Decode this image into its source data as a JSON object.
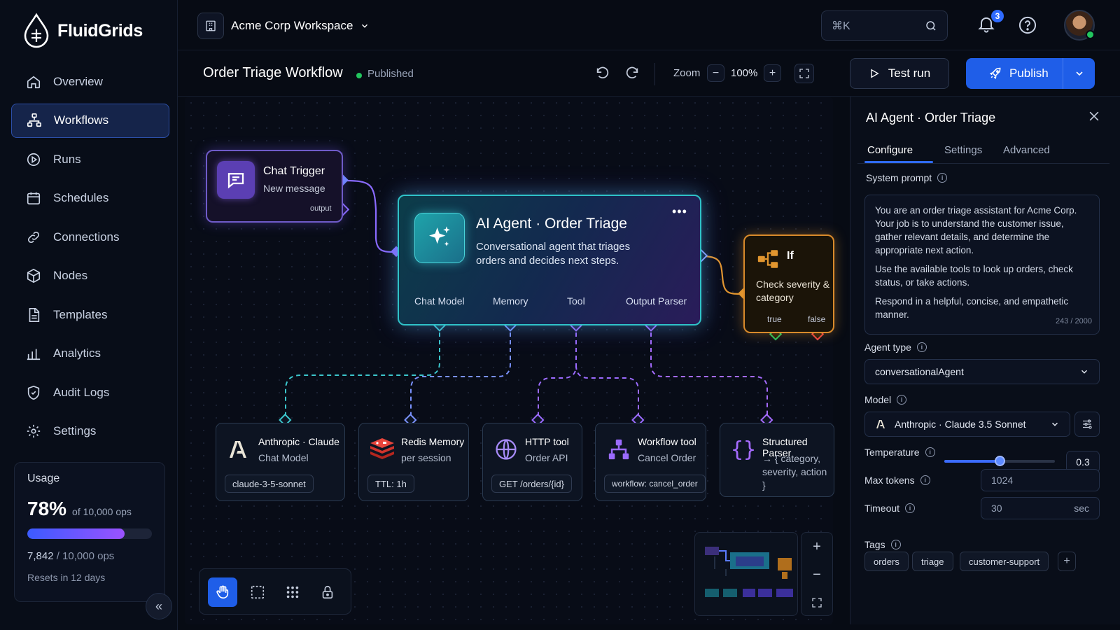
{
  "app": {
    "name": "FluidGrids"
  },
  "sidebar": {
    "items": [
      {
        "label": "Overview",
        "icon": "home-icon"
      },
      {
        "label": "Workflows",
        "icon": "workflow-icon",
        "active": true
      },
      {
        "label": "Runs",
        "icon": "play-circle-icon"
      },
      {
        "label": "Schedules",
        "icon": "calendar-icon"
      },
      {
        "label": "Connections",
        "icon": "link-icon"
      },
      {
        "label": "Nodes",
        "icon": "cube-icon"
      },
      {
        "label": "Templates",
        "icon": "document-icon"
      },
      {
        "label": "Analytics",
        "icon": "bar-chart-icon"
      },
      {
        "label": "Audit Logs",
        "icon": "shield-icon"
      },
      {
        "label": "Settings",
        "icon": "gear-icon"
      }
    ],
    "usage": {
      "title": "Usage",
      "percent_label": "78%",
      "of_label": "of 10,000 ops",
      "fraction": 0.78,
      "used": "7,842",
      "total": "/ 10,000 ops",
      "resets": "Resets in 12 days"
    }
  },
  "topbar": {
    "workspace": "Acme Corp Workspace",
    "search_shortcut": "⌘K",
    "notifications_count": "3"
  },
  "toolbar": {
    "title": "Order Triage Workflow",
    "status": "Published",
    "zoom_label": "Zoom",
    "zoom_value": "100%",
    "test_run": "Test run",
    "publish": "Publish"
  },
  "canvas": {
    "trigger": {
      "title": "Chat Trigger",
      "subtitle": "New message",
      "port": "output"
    },
    "agent": {
      "title": "AI Agent · Order Triage",
      "description": "Conversational agent that triages orders and decides next steps.",
      "ports": [
        "Chat Model",
        "Memory",
        "Tool",
        "Output Parser"
      ]
    },
    "if_node": {
      "title": "If",
      "description": "Check severity & category",
      "true_label": "true",
      "false_label": "false"
    },
    "subnodes": [
      {
        "title": "Anthropic · Claude",
        "subtitle": "Chat Model",
        "pill": "claude-3-5-sonnet"
      },
      {
        "title": "Redis Memory",
        "subtitle": "per session",
        "pill": "TTL: 1h"
      },
      {
        "title": "HTTP tool",
        "subtitle": "Order API",
        "pill": "GET /orders/{id}"
      },
      {
        "title": "Workflow tool",
        "subtitle": "Cancel Order",
        "pill": "workflow: cancel_order"
      },
      {
        "title": "Structured Parser",
        "subtitle": "→ { category, severity, action }"
      }
    ]
  },
  "panel": {
    "title": "AI Agent · Order Triage",
    "tabs": [
      "Configure",
      "Settings",
      "Advanced"
    ],
    "system_prompt_label": "System prompt",
    "system_prompt": [
      "You are an order triage assistant for Acme Corp. Your job is to understand the customer issue, gather relevant details, and determine the appropriate next action.",
      "Use the available tools to look up orders, check status, or take actions.",
      "Respond in a helpful, concise, and empathetic manner."
    ],
    "char_count": "243 / 2000",
    "agent_type_label": "Agent type",
    "agent_type": "conversationalAgent",
    "model_label": "Model",
    "model": "Anthropic · Claude 3.5 Sonnet",
    "temperature_label": "Temperature",
    "temperature": "0.3",
    "temperature_fraction": 0.5,
    "max_tokens_label": "Max tokens",
    "max_tokens": "1024",
    "timeout_label": "Timeout",
    "timeout": "30",
    "timeout_unit": "sec",
    "tags_label": "Tags",
    "tags": [
      "orders",
      "triage",
      "customer-support"
    ]
  },
  "colors": {
    "accent": "#2f6bff",
    "agent": "#2fc2c8",
    "trigger": "#6f5bc9",
    "if": "#d98a2b",
    "success": "#22c55e"
  }
}
